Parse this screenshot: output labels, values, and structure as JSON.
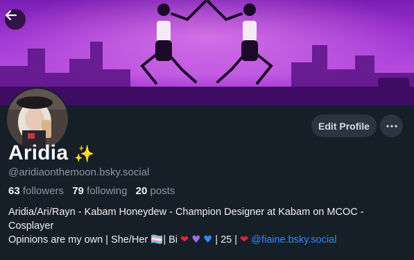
{
  "profile": {
    "display_name": "Aridia",
    "name_emoji": "✨",
    "handle": "@aridiaonthemoon.bsky.social",
    "stats": {
      "followers_count": "63",
      "followers_label": "followers",
      "following_count": "79",
      "following_label": "following",
      "posts_count": "20",
      "posts_label": "posts"
    },
    "bio": {
      "line1": "Aridia/Ari/Rayn - Kabam Honeydew - Champion Designer at Kabam on MCOC - Cosplayer",
      "line2_a": "Opinions are my own | She/Her ",
      "flag_emoji": "🏳️‍⚧️",
      "line2_b": "| Bi ",
      "heart_red": "❤",
      "heart_purple": "♥",
      "heart_blue": "♥",
      "line2_c": "| 25 | ",
      "heart_mend": "❤",
      "mention": "@fiaine.bsky.social"
    }
  },
  "actions": {
    "edit_profile_label": "Edit Profile"
  },
  "colors": {
    "background": "#161e27",
    "accent_link": "#2f8cff",
    "banner": "#a33ad6"
  }
}
